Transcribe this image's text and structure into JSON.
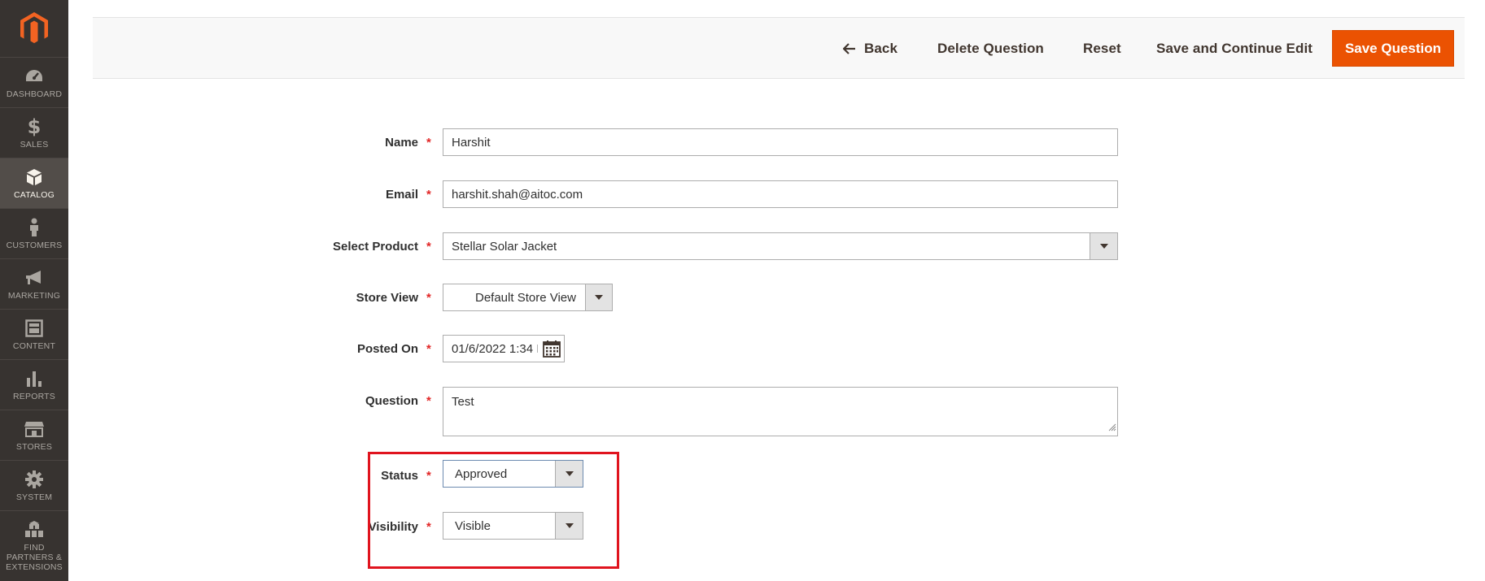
{
  "sidebar": {
    "items": [
      {
        "label": "DASHBOARD",
        "icon": "dashboard-icon"
      },
      {
        "label": "SALES",
        "icon": "dollar-icon"
      },
      {
        "label": "CATALOG",
        "icon": "box-icon",
        "active": true
      },
      {
        "label": "CUSTOMERS",
        "icon": "person-icon"
      },
      {
        "label": "MARKETING",
        "icon": "megaphone-icon"
      },
      {
        "label": "CONTENT",
        "icon": "layout-icon"
      },
      {
        "label": "REPORTS",
        "icon": "bar-chart-icon"
      },
      {
        "label": "STORES",
        "icon": "store-icon"
      },
      {
        "label": "SYSTEM",
        "icon": "gear-icon"
      },
      {
        "label": "FIND PARTNERS & EXTENSIONS",
        "icon": "cubes-icon"
      }
    ]
  },
  "actions": {
    "back": "Back",
    "delete": "Delete Question",
    "reset": "Reset",
    "save_continue": "Save and Continue Edit",
    "save": "Save Question"
  },
  "form": {
    "name": {
      "label": "Name",
      "value": "Harshit"
    },
    "email": {
      "label": "Email",
      "value": "harshit.shah@aitoc.com"
    },
    "product": {
      "label": "Select Product",
      "value": "Stellar Solar Jacket"
    },
    "store_view": {
      "label": "Store View",
      "value": "Default Store View"
    },
    "posted_on": {
      "label": "Posted On",
      "value": "01/6/2022 1:34 I"
    },
    "question": {
      "label": "Question",
      "value": "Test"
    },
    "status": {
      "label": "Status",
      "value": "Approved"
    },
    "visibility": {
      "label": "Visibility",
      "value": "Visible"
    }
  },
  "required_marker": "*",
  "colors": {
    "sidebar_bg": "#373330",
    "accent": "#eb5202",
    "required": "#e22626",
    "highlight": "#e0141e"
  }
}
